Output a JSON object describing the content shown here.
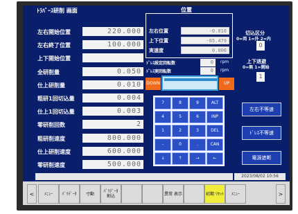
{
  "screen_title": "ﾄﾗﾊﾞｰｽ研削 画面",
  "position_panel": {
    "title": "位置",
    "rows": [
      {
        "label": "左右位置",
        "value": "-0.010"
      },
      {
        "label": "上下位置",
        "value": "-65.479"
      },
      {
        "label": "実速度",
        "value": "0.000"
      }
    ]
  },
  "left_fields": [
    {
      "label": "左右開始位置",
      "value": "220.000"
    },
    {
      "label": "左右終了位置",
      "value": "100.000"
    },
    {
      "label": "上下開始位置",
      "value": ""
    },
    {
      "label": "全研削量",
      "value": "0.050"
    },
    {
      "label": "仕上研削量",
      "value": "0.010"
    },
    {
      "label": "粗研1回切込量",
      "value": "0.004"
    },
    {
      "label": "仕上1回切込量",
      "value": "0.003"
    },
    {
      "label": "零研削回数",
      "value": "2"
    },
    {
      "label": "粗研削速度",
      "value": "800.000"
    },
    {
      "label": "仕上研削速度",
      "value": "600.000"
    },
    {
      "label": "零研削速度",
      "value": "500.000"
    }
  ],
  "rpm_rows": [
    {
      "label": "ﾄﾞﾚｽ設定回転数",
      "value": "0",
      "unit": "rpm"
    },
    {
      "label": "ﾄﾞﾚｽ実回転数",
      "value": "0",
      "unit": "rpm"
    }
  ],
  "jog": {
    "down": "DOWN",
    "up": "UP"
  },
  "cut_section": {
    "title1": "切込区分",
    "title2": "0=両 1=外 2=内",
    "value": "0"
  },
  "vertical_retreat": {
    "title1": "上下退避",
    "title2": "0=無 1=開始",
    "value": "1"
  },
  "keypad": [
    "7",
    "8",
    "9",
    "ALT",
    "4",
    "5",
    "6",
    "INP",
    "1",
    "2",
    "3",
    "DEL",
    "-",
    "0",
    ".",
    "CAN",
    "↓",
    "↑",
    "→",
    "←"
  ],
  "right_buttons": [
    "左右不等速",
    "ﾄﾞﾚｽ不等速",
    "電源遮断"
  ],
  "datetime": "2023/08/02 10:56",
  "bottom_bar": {
    "prev": "<",
    "next": ">",
    "buttons": [
      "ﾒﾆｭｰ",
      "ﾊﾞﾘﾃﾞｰﾀ",
      "寸動",
      "ﾊﾞﾘﾃﾞｰﾀ 割込",
      "",
      "",
      "異常 表示",
      "",
      "初期 ﾘｾｯﾄ",
      "ﾒﾆｭｰ"
    ]
  },
  "colors": {
    "screen_bg": "#0a1f6b",
    "accent_yellow": "#f0ee3a",
    "jog_orange": "#f06a1c",
    "keypad_blue": "#2b50c6"
  }
}
